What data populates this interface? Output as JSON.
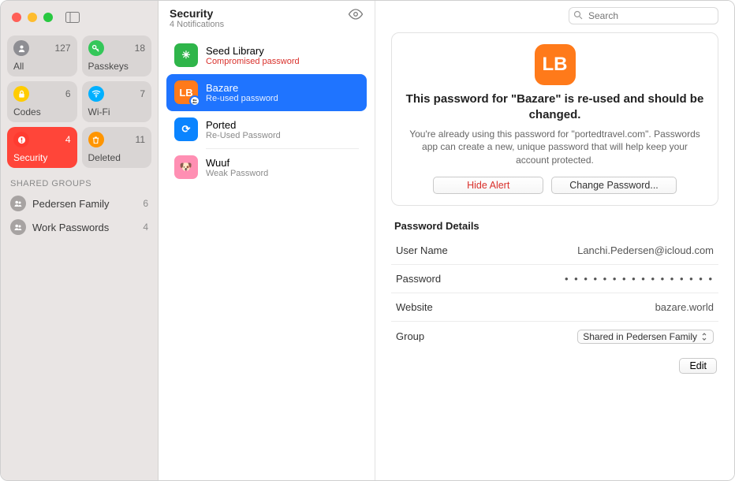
{
  "sidebar": {
    "tiles": [
      {
        "id": "all",
        "label": "All",
        "count": 127,
        "color": "#8e8e93",
        "icon": "person"
      },
      {
        "id": "passkeys",
        "label": "Passkeys",
        "count": 18,
        "color": "#34c759",
        "icon": "key"
      },
      {
        "id": "codes",
        "label": "Codes",
        "count": 6,
        "color": "#ffcc00",
        "icon": "lock"
      },
      {
        "id": "wifi",
        "label": "Wi-Fi",
        "count": 7,
        "color": "#00b0ff",
        "icon": "wifi"
      },
      {
        "id": "security",
        "label": "Security",
        "count": 4,
        "color": "#ff3b30",
        "icon": "alert",
        "active": true
      },
      {
        "id": "deleted",
        "label": "Deleted",
        "count": 11,
        "color": "#ff9500",
        "icon": "trash"
      }
    ],
    "shared_header": "Shared Groups",
    "groups": [
      {
        "label": "Pedersen Family",
        "count": 6
      },
      {
        "label": "Work Passwords",
        "count": 4
      }
    ]
  },
  "mid": {
    "title": "Security",
    "subtitle": "4 Notifications",
    "items": [
      {
        "name": "Seed Library",
        "sub": "Compromised password",
        "sub_bad": true,
        "selected": false,
        "icon_bg": "#2fb54a",
        "icon_text": "✳",
        "shared": false
      },
      {
        "name": "Bazare",
        "sub": "Re-used password",
        "sub_bad": false,
        "selected": true,
        "icon_bg": "#ff7a1a",
        "icon_text": "LB",
        "shared": true
      },
      {
        "name": "Ported",
        "sub": "Re-Used Password",
        "sub_bad": false,
        "selected": false,
        "icon_bg": "#0a84ff",
        "icon_text": "⟳",
        "shared": false
      },
      {
        "name": "Wuuf",
        "sub": "Weak Password",
        "sub_bad": false,
        "selected": false,
        "icon_bg": "#ff8fb3",
        "icon_text": "🐶",
        "shared": false
      }
    ]
  },
  "search": {
    "placeholder": "Search"
  },
  "detail": {
    "icon_bg": "#ff7a1a",
    "icon_text": "LB",
    "headline": "This password for \"Bazare\" is re-used and should be changed.",
    "description": "You're already using this password for \"portedtravel.com\". Passwords app can create a new, unique password that will help keep your account protected.",
    "hide_alert_label": "Hide Alert",
    "change_password_label": "Change Password...",
    "section_title": "Password Details",
    "rows": {
      "username_label": "User Name",
      "username_value": "Lanchi.Pedersen@icloud.com",
      "password_label": "Password",
      "password_value": "• • • • • • • • • • • • • • • •",
      "website_label": "Website",
      "website_value": "bazare.world",
      "group_label": "Group",
      "group_value": "Shared in Pedersen Family"
    },
    "edit_label": "Edit"
  }
}
